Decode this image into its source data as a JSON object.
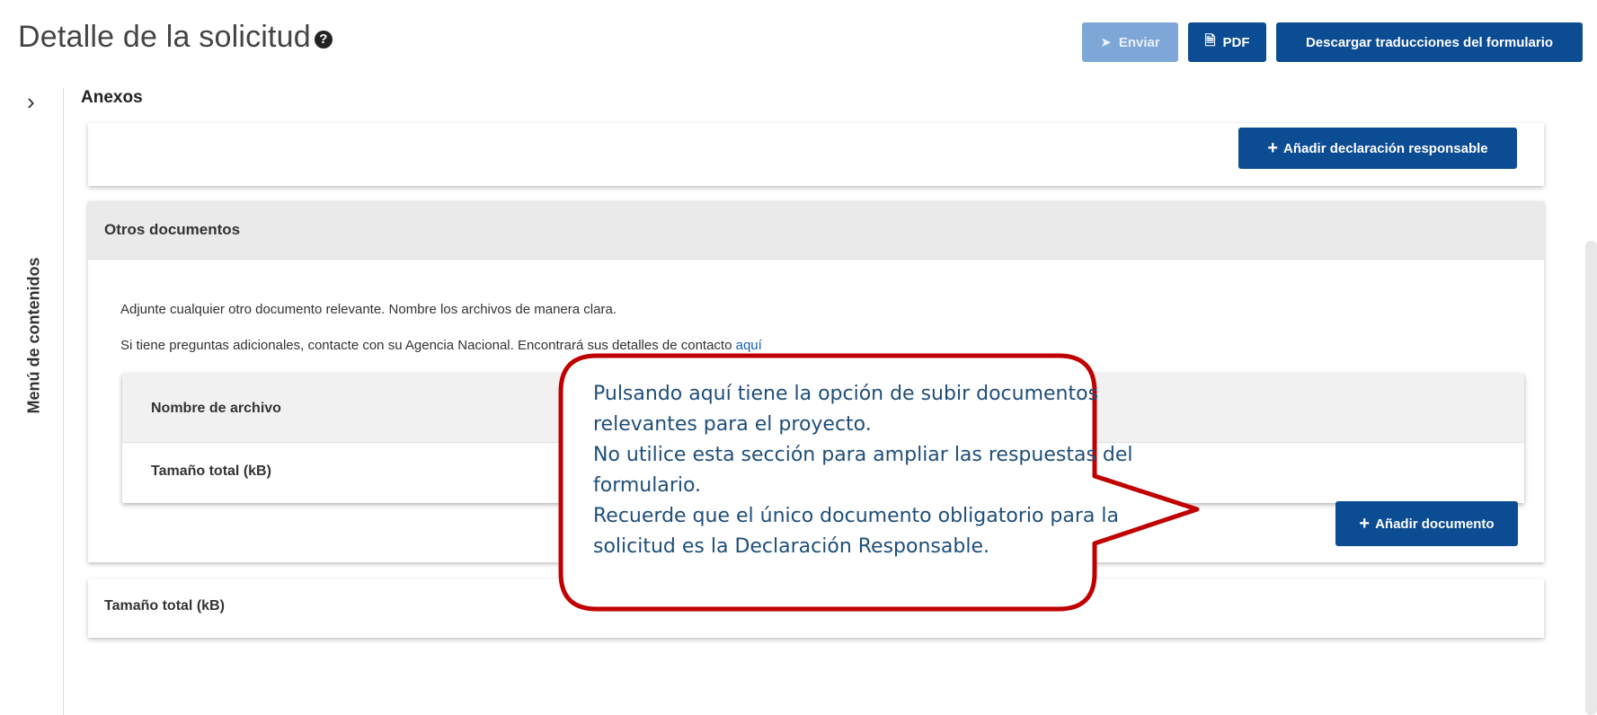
{
  "header": {
    "title": "Detalle de la solicitud",
    "help_icon": "question-circle-icon",
    "buttons": {
      "send": "Enviar",
      "pdf": "PDF",
      "translations": "Descargar traducciones del formulario"
    }
  },
  "sidebar": {
    "toggle_icon": "chevron-right-icon",
    "label": "Menú de contenidos"
  },
  "section": {
    "title": "Anexos"
  },
  "declaration_card": {
    "add_button": "Añadir declaración responsable"
  },
  "other_documents": {
    "title": "Otros documentos",
    "instruction_1": "Adjunte cualquier otro documento relevante. Nombre los archivos de manera clara.",
    "instruction_2_prefix": "Si tiene preguntas adicionales, contacte con su Agencia Nacional. Encontrará sus detalles de contacto ",
    "instruction_2_link": "aquí",
    "table": {
      "header": "Nombre de archivo",
      "total_label": "Tamaño total (kB)"
    },
    "add_button": "Añadir documento"
  },
  "totals_card": {
    "label": "Tamaño total (kB)"
  },
  "callout": {
    "lines": [
      "Pulsando aquí tiene la opción de subir documentos",
      "relevantes para el proyecto.",
      "No utilice esta sección para ampliar las respuestas del",
      "formulario.",
      "Recuerde que el único documento obligatorio para la",
      "solicitud es la Declaración Responsable."
    ],
    "border_color": "#c00000",
    "text_color": "#1f4e79"
  },
  "colors": {
    "primary": "#0b4c93",
    "disabled": "#7ea6d6"
  }
}
